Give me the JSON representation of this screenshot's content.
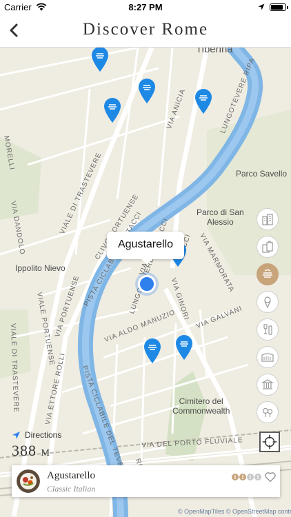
{
  "status_bar": {
    "carrier": "Carrier",
    "time": "8:27 PM",
    "battery_level": 0.85
  },
  "nav": {
    "title": "Discover Rome",
    "back_icon": "chevron-left-icon"
  },
  "map": {
    "labels": {
      "tiberina": "Tiberina",
      "parco_savello": "Parco Savello",
      "parco_san_alessio": "Parco di San\nAlessio",
      "ippolito_nievo": "Ippolito Nievo",
      "cimitero": "Cimitero del\nCommonwealth",
      "via_anicia": "VIA ANICIA",
      "lungotevere_ripa": "LUNGOTEVERE RIPA",
      "via_dandolo": "VIA DANDOLO",
      "morelli": "MORELLI",
      "viale_trastevere_top": "VIALE DI TRASTEVERE",
      "viale_trastevere_bottom": "VIALE DI TRASTEVERE",
      "clivo_portuense": "CLIVO PORTUENSE",
      "pista_testacci": "PISTA CICLABILE TESTACCI",
      "cci": "CCI",
      "via_marmorata": "VIA MARMORATA",
      "lungotevere_testacci": "LUNGOTEVERE TESTACCI",
      "via_ginori": "VIA GINORI",
      "via_galvani": "VIA GALVANI",
      "via_aldo_manuzio": "VIA ALDO MANUZIO",
      "via_portuense": "VIA PORTUENSE",
      "viale_portuense": "VIALE PORTUENSE",
      "via_ettore_rolli": "VIA ETTORE ROLLI",
      "pista_tevere": "PISTA CICLABILE DEL TEVERE",
      "via_porto_fluviale": "VIA DEL PORTO FLUVIALE",
      "ri": "RI",
      "via_short": "VIA"
    },
    "tooltip": "Agustarello",
    "directions_label": "Directions",
    "distance_value": "388",
    "distance_unit": "M",
    "attribution": "© OpenMapTiles  © OpenStreetMap contributors"
  },
  "categories": [
    {
      "name": "architecture",
      "icon": "buildings-icon",
      "active": false
    },
    {
      "name": "shopping",
      "icon": "shopping-bags-icon",
      "active": false
    },
    {
      "name": "restaurants",
      "icon": "restaurant-icon",
      "active": true
    },
    {
      "name": "gelato",
      "icon": "ice-cream-icon",
      "active": false
    },
    {
      "name": "drinks",
      "icon": "wine-icon",
      "active": false
    },
    {
      "name": "colosseum",
      "icon": "colosseum-icon",
      "active": false
    },
    {
      "name": "museums",
      "icon": "museum-icon",
      "active": false
    },
    {
      "name": "parks",
      "icon": "trees-icon",
      "active": false
    }
  ],
  "place_card": {
    "name": "Agustarello",
    "cuisine": "Classic Italian",
    "price_level": 2,
    "price_max": 4,
    "favorite": false
  },
  "colors": {
    "accent": "#c8a47b",
    "pin": "#1e88e5",
    "river": "#7fb6e6",
    "user_location": "#2f80ed"
  }
}
